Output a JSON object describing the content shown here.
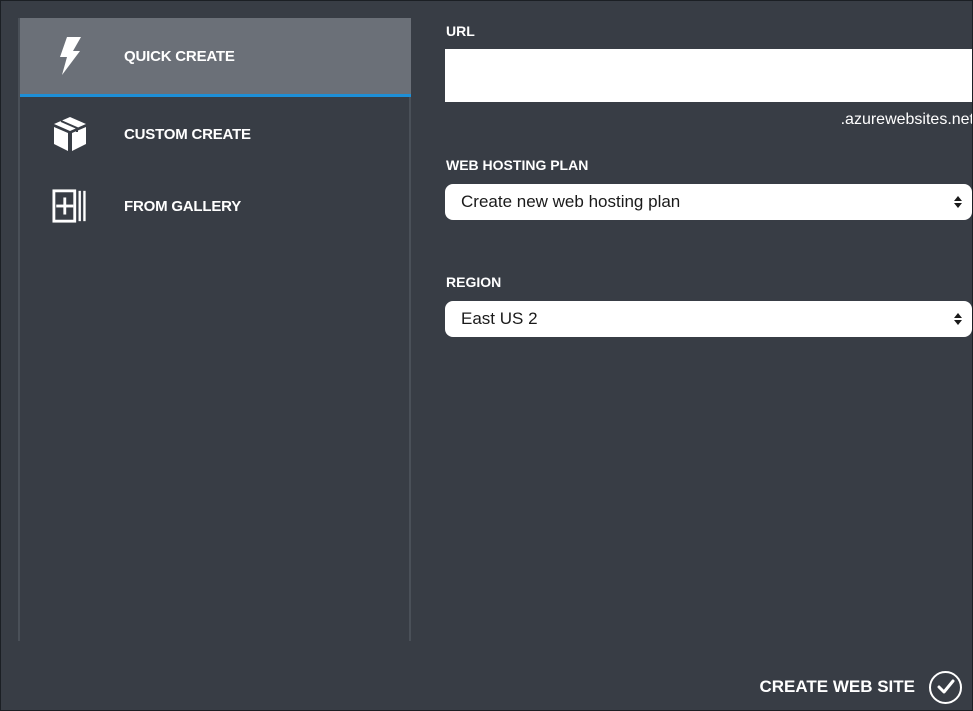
{
  "sidebar": {
    "items": [
      {
        "label": "QUICK CREATE",
        "icon": "lightning-icon",
        "active": true
      },
      {
        "label": "CUSTOM CREATE",
        "icon": "package-box-icon",
        "active": false
      },
      {
        "label": "FROM GALLERY",
        "icon": "gallery-add-icon",
        "active": false
      }
    ]
  },
  "form": {
    "url_label": "URL",
    "url_value": "",
    "url_suffix": ".azurewebsites.net",
    "hosting_plan_label": "WEB HOSTING PLAN",
    "hosting_plan_value": "Create new web hosting plan",
    "region_label": "REGION",
    "region_value": "East US 2"
  },
  "footer": {
    "create_label": "CREATE WEB SITE",
    "confirm_icon": "checkmark-icon"
  },
  "colors": {
    "background": "#383d45",
    "active_item": "#6b7078",
    "accent": "#1e8fd6",
    "text": "#ffffff"
  }
}
